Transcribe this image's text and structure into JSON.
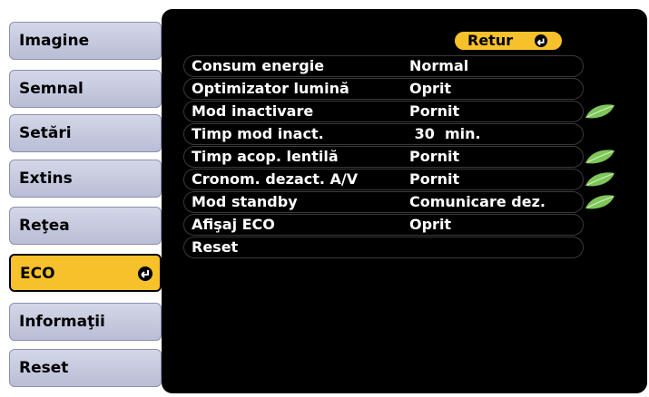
{
  "sidebar": {
    "items": [
      {
        "label": "Imagine",
        "selected": false
      },
      {
        "label": "Semnal",
        "selected": false
      },
      {
        "label": "Setări",
        "selected": false
      },
      {
        "label": "Extins",
        "selected": false
      },
      {
        "label": "Reţea",
        "selected": false
      },
      {
        "label": "ECO",
        "selected": true
      },
      {
        "label": "Informaţii",
        "selected": false
      },
      {
        "label": "Reset",
        "selected": false
      }
    ]
  },
  "panel": {
    "back_label": "Retur",
    "rows": [
      {
        "label": "Consum energie",
        "value": "Normal",
        "eco": false
      },
      {
        "label": "Optimizator lumină",
        "value": "Oprit",
        "eco": false
      },
      {
        "label": "Mod inactivare",
        "value": "Pornit",
        "eco": true
      },
      {
        "label": "Timp mod inact.",
        "value": " 30  min.",
        "eco": false
      },
      {
        "label": "Timp acop. lentilă",
        "value": "Pornit",
        "eco": true
      },
      {
        "label": "Cronom. dezact. A/V",
        "value": "Pornit",
        "eco": true
      },
      {
        "label": "Mod standby",
        "value": "Comunicare dez.",
        "eco": true
      },
      {
        "label": "Afişaj ECO",
        "value": "Oprit",
        "eco": false
      },
      {
        "label": "Reset",
        "value": "",
        "eco": false
      }
    ]
  },
  "colors": {
    "accent": "#f7c12b",
    "menu_bg": "#c6c9de",
    "panel_bg": "#000000",
    "leaf": "#7ec65a"
  },
  "icons": {
    "enter": "enter-icon",
    "eco": "eco-leaf-icon"
  }
}
